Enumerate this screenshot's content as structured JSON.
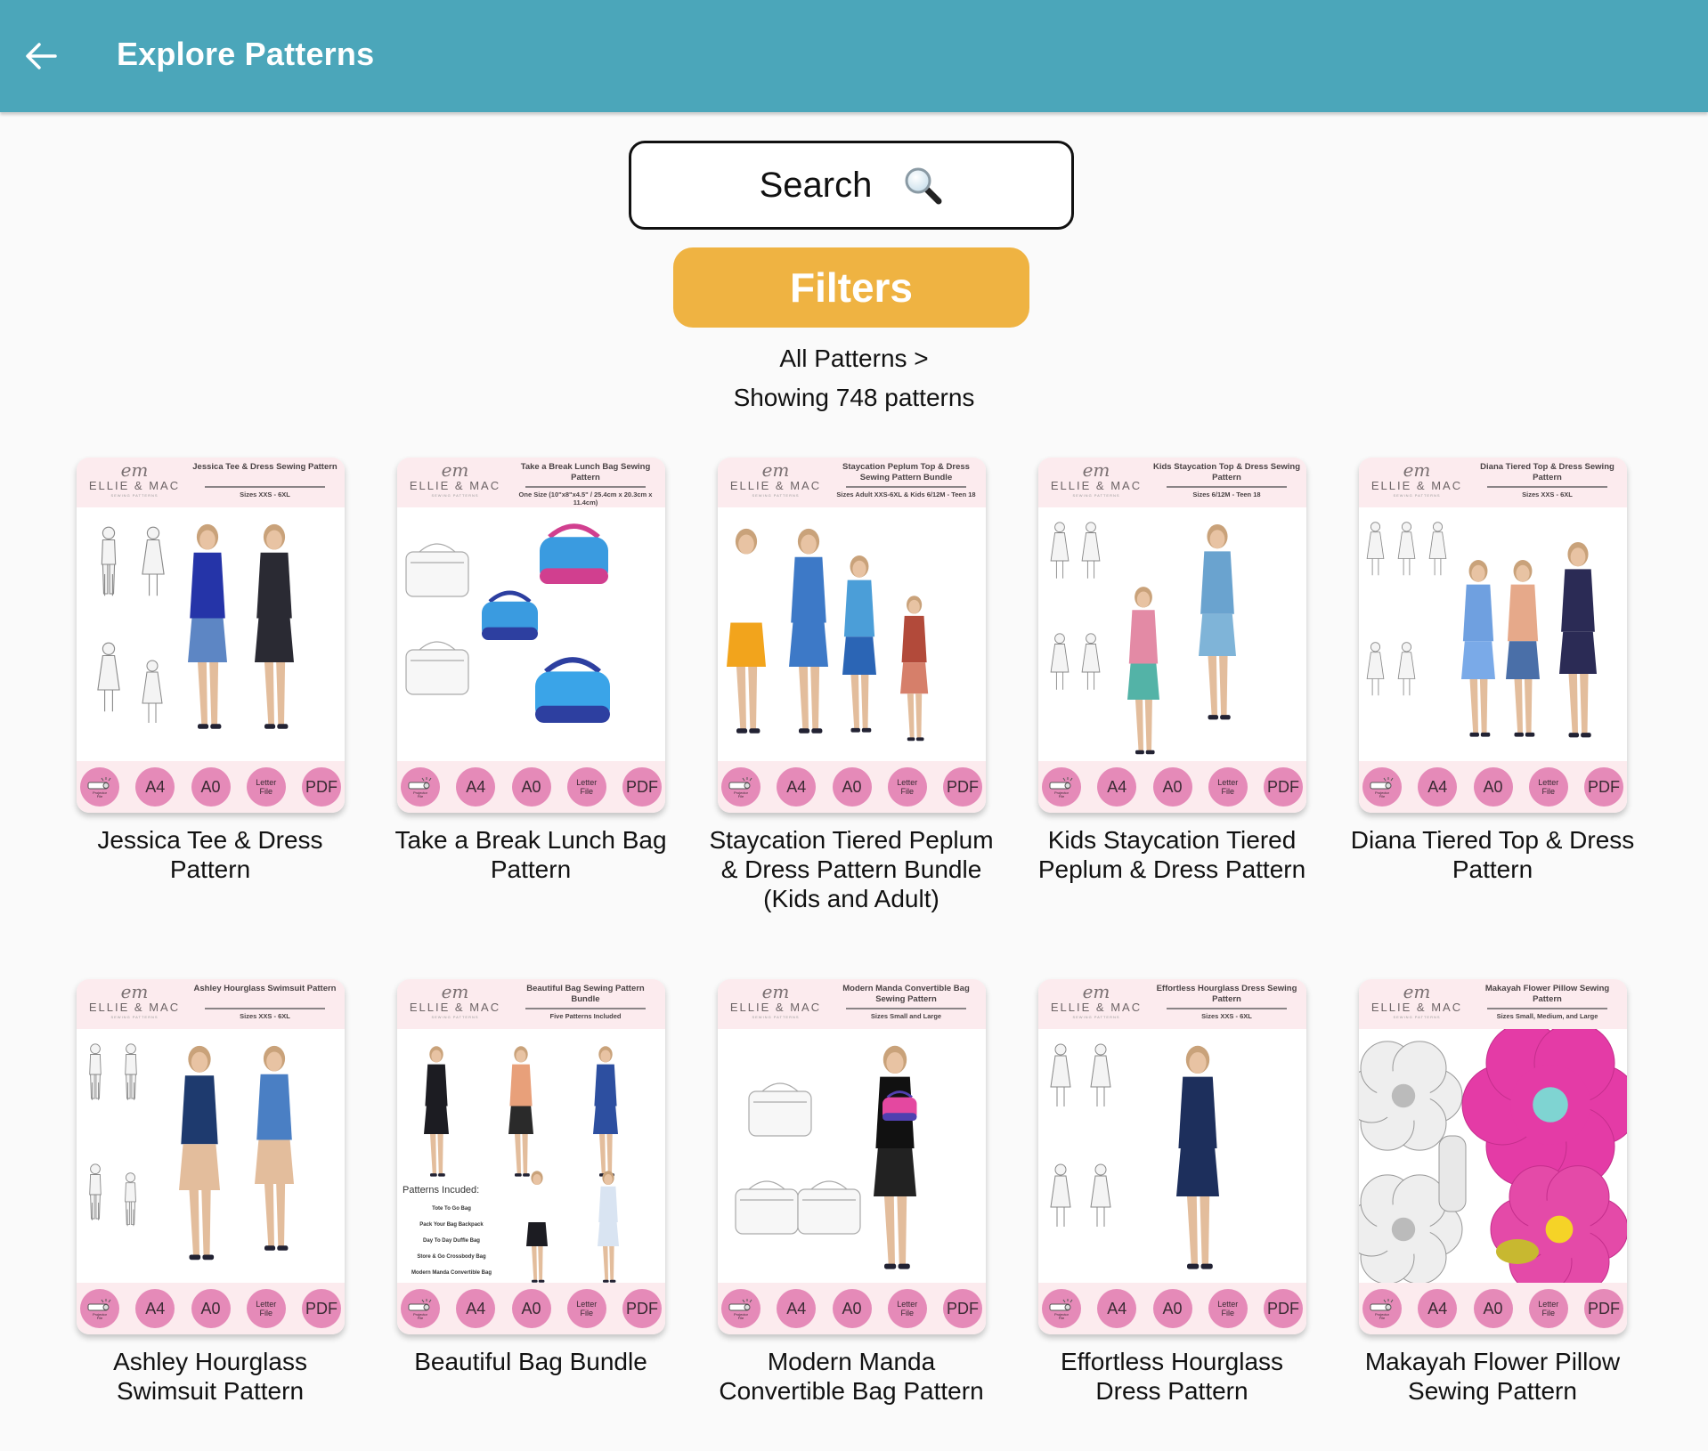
{
  "appbar": {
    "title": "Explore Patterns",
    "back_icon": "arrow-left-icon",
    "color": "#4ba6ba"
  },
  "search": {
    "label": "Search",
    "icon": "magnifying-glass-icon"
  },
  "filters": {
    "label": "Filters",
    "color": "#efb342"
  },
  "breadcrumb": "All Patterns >",
  "count_text": "Showing 748 patterns",
  "format_badges": {
    "projector": "Projector File",
    "a4": "A4",
    "a0": "A0",
    "letter_line1": "Letter",
    "letter_line2": "File",
    "pdf": "PDF",
    "color": "#e58ab8"
  },
  "brand": {
    "monogram": "em",
    "name": "ELLIE & MAC",
    "tagline": "SEWING PATTERNS"
  },
  "patterns": [
    {
      "title": "Jessica Tee & Dress Pattern",
      "cover_title": "Jessica Tee & Dress Sewing Pattern",
      "cover_sizes": "Sizes XXS - 6XL"
    },
    {
      "title": "Take a Break Lunch Bag Pattern",
      "cover_title": "Take a Break Lunch Bag Sewing Pattern",
      "cover_sizes": "One Size (10\"x8\"x4.5\" / 25.4cm x 20.3cm x 11.4cm)"
    },
    {
      "title": "Staycation Tiered Peplum & Dress Pattern Bundle (Kids and Adult)",
      "cover_title": "Staycation Peplum Top & Dress Sewing Pattern Bundle",
      "cover_sizes": "Sizes Adult XXS-6XL & Kids 6/12M - Teen 18"
    },
    {
      "title": "Kids Staycation Tiered Peplum & Dress Pattern",
      "cover_title": "Kids Staycation Top & Dress Sewing Pattern",
      "cover_sizes": "Sizes 6/12M - Teen 18"
    },
    {
      "title": "Diana Tiered Top & Dress Pattern",
      "cover_title": "Diana Tiered Top & Dress Sewing Pattern",
      "cover_sizes": "Sizes XXS - 6XL"
    },
    {
      "title": "Ashley Hourglass Swimsuit Pattern",
      "cover_title": "Ashley Hourglass Swimsuit Pattern",
      "cover_sizes": "Sizes XXS - 6XL"
    },
    {
      "title": "Beautiful Bag Bundle",
      "cover_title": "Beautiful Bag Sewing Pattern Bundle",
      "cover_sizes": "Five Patterns Included",
      "included_heading": "Patterns Incuded:",
      "included": [
        "Tote To Go Bag",
        "Pack Your Bag Backpack",
        "Day To Day Duffle Bag",
        "Store & Go Crossbody Bag",
        "Modern Manda Convertible Bag"
      ]
    },
    {
      "title": "Modern Manda Convertible Bag Pattern",
      "cover_title": "Modern Manda Convertible Bag Sewing Pattern",
      "cover_sizes": "Sizes Small and Large"
    },
    {
      "title": "Effortless Hourglass Dress Pattern",
      "cover_title": "Effortless Hourglass Dress Sewing Pattern",
      "cover_sizes": "Sizes XXS - 6XL"
    },
    {
      "title": "Makayah Flower Pillow Sewing Pattern",
      "cover_title": "Makayah Flower Pillow Sewing Pattern",
      "cover_sizes": "Sizes Small, Medium, and Large"
    }
  ]
}
